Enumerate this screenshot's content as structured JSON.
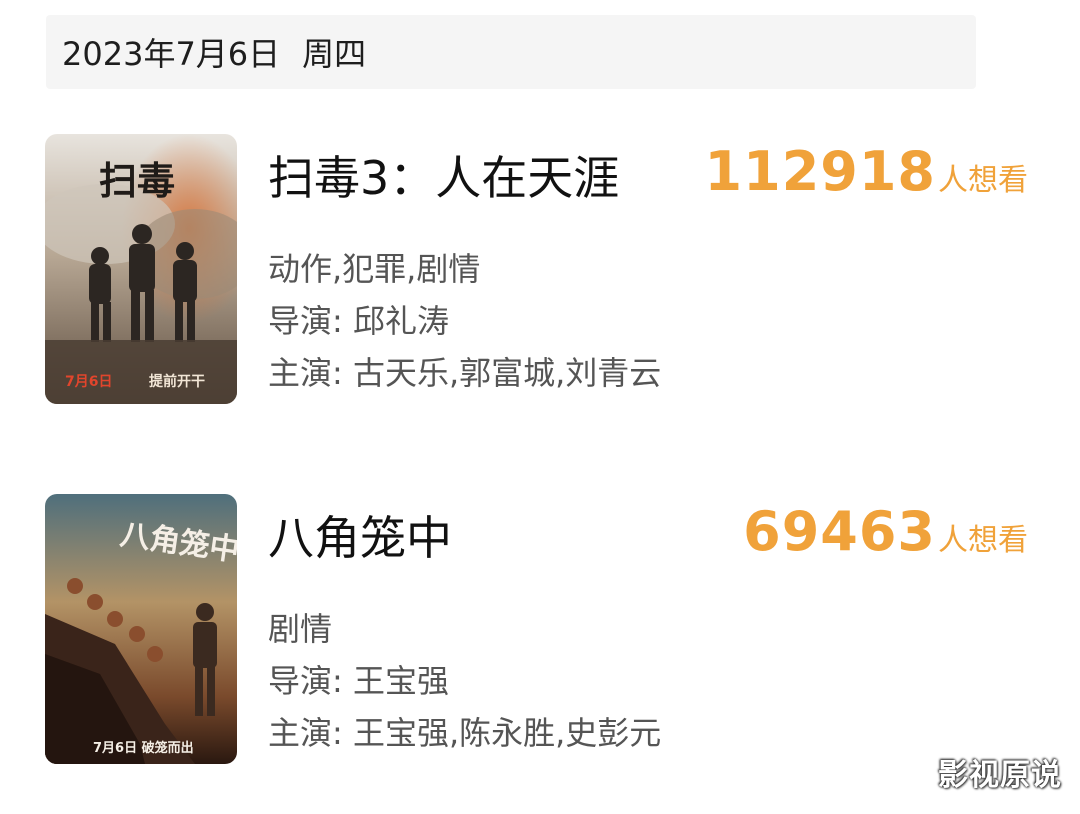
{
  "date_header": {
    "date": "2023年7月6日",
    "weekday": "周四"
  },
  "movies": [
    {
      "title": "扫毒3：人在天涯",
      "want_count": "112918",
      "want_suffix": "人想看",
      "genres": "动作,犯罪,剧情",
      "director": "导演: 邱礼涛",
      "cast": "主演: 古天乐,郭富城,刘青云",
      "poster": {
        "title_text": "扫毒",
        "release_text": "7月6日",
        "tagline": "提前开干",
        "palette": [
          "#d9d4cc",
          "#a99a86",
          "#6b5a49",
          "#c25a2a"
        ]
      }
    },
    {
      "title": "八角笼中",
      "want_count": "69463",
      "want_suffix": "人想看",
      "genres": "剧情",
      "director": "导演: 王宝强",
      "cast": "主演: 王宝强,陈永胜,史彭元",
      "poster": {
        "title_text": "八角笼中",
        "release_text": "7月6日 破笼而出",
        "palette": [
          "#5a7a86",
          "#c9a36a",
          "#6b3c25",
          "#2d1a12"
        ]
      }
    }
  ],
  "watermark": "影视原说",
  "colors": {
    "accent": "#f0a23a",
    "date_bar_bg": "#f5f5f5",
    "text_main": "#111111",
    "text_secondary": "#555555"
  }
}
